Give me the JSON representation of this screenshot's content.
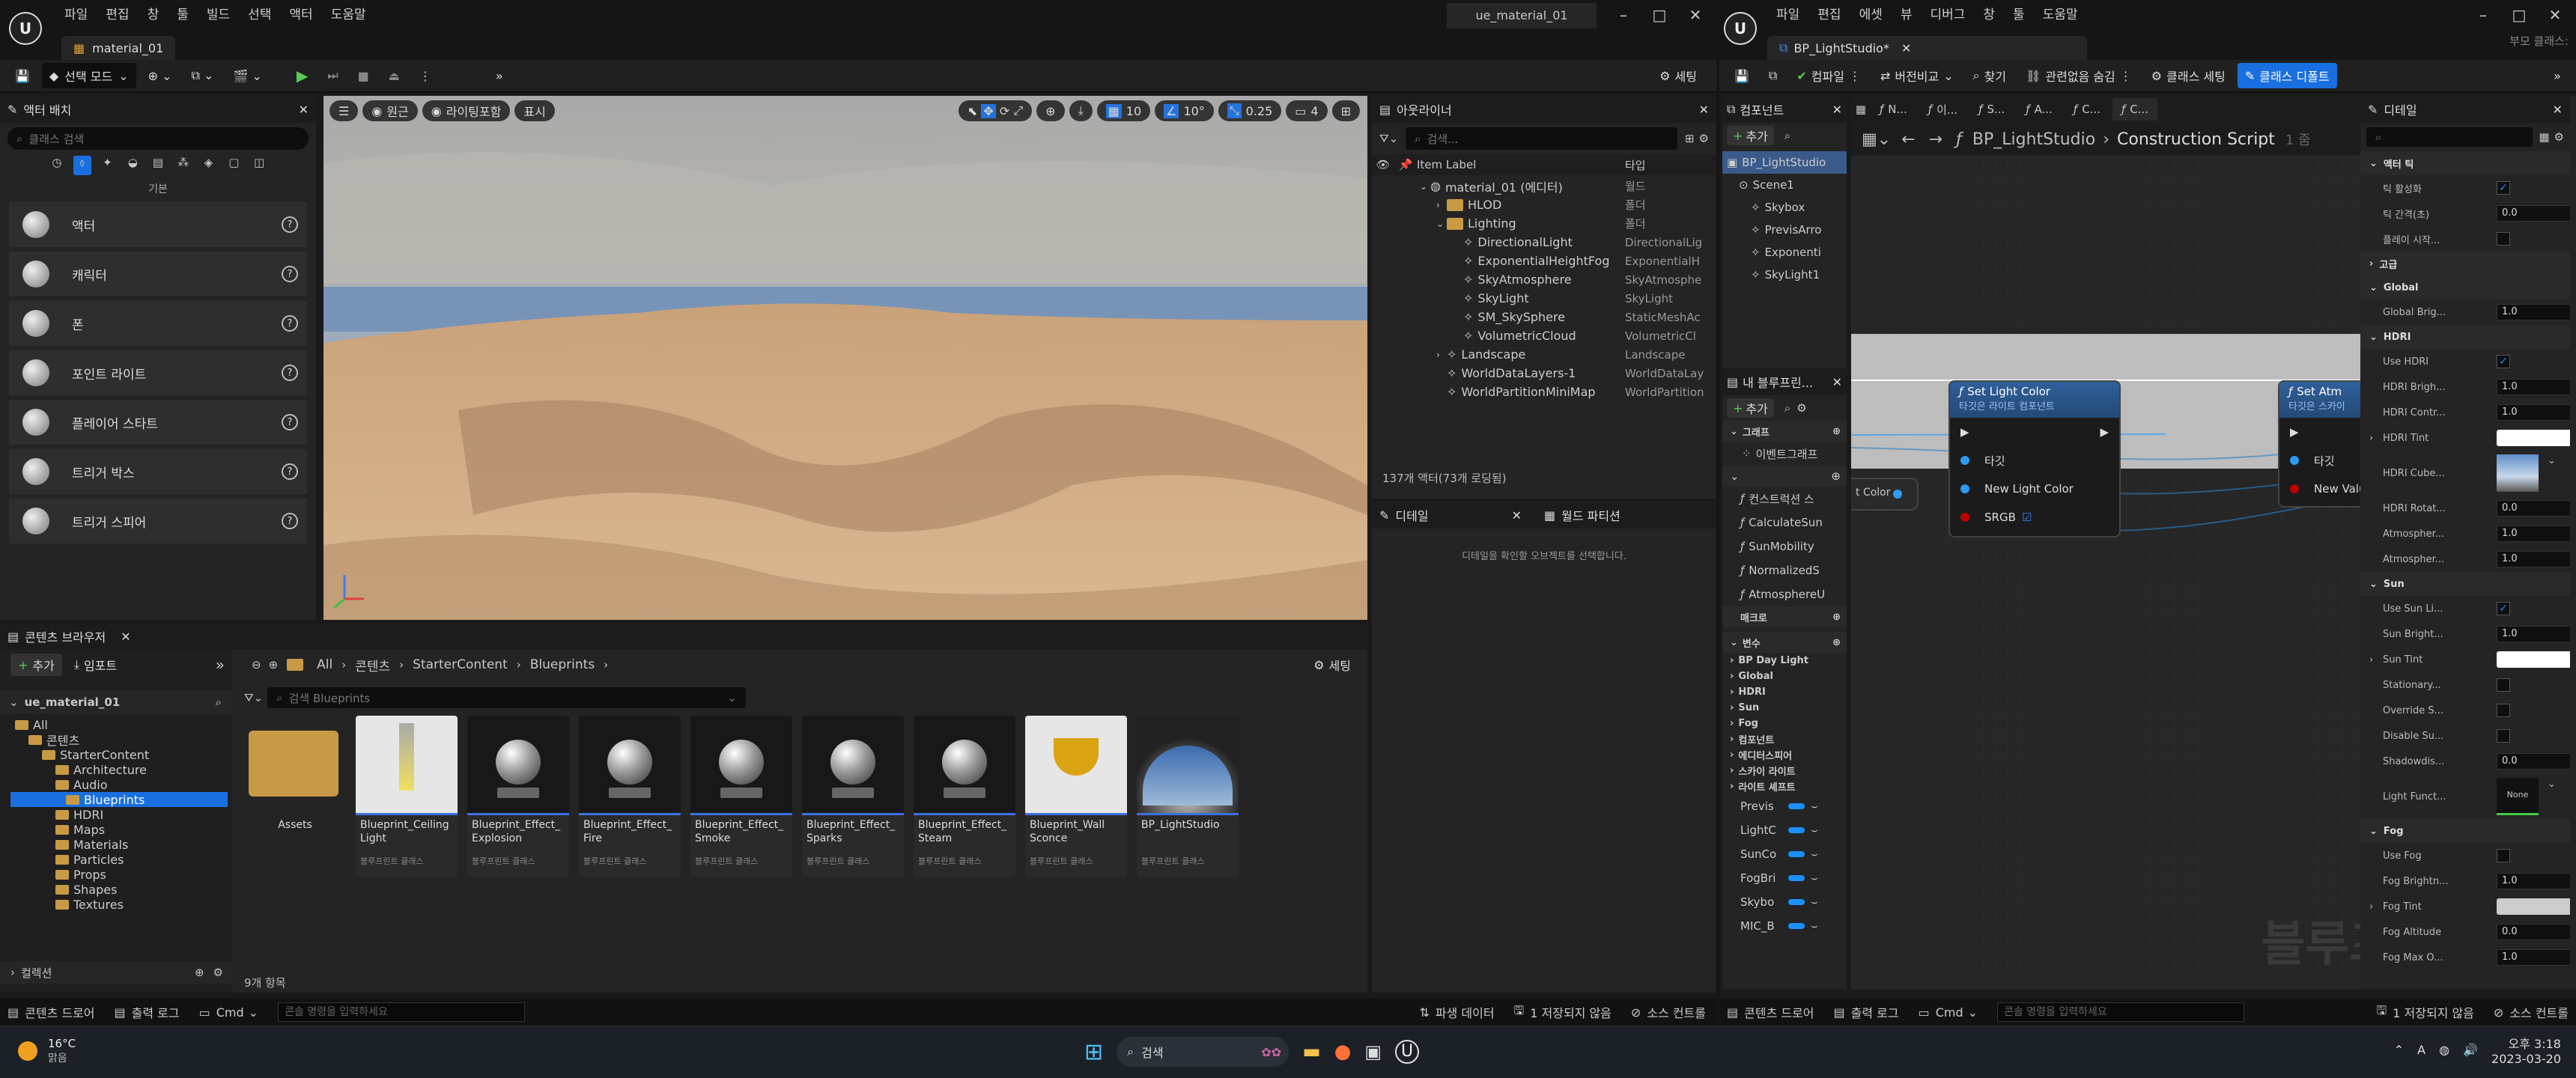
{
  "left_window": {
    "menu": [
      "파일",
      "편집",
      "창",
      "툴",
      "빌드",
      "선택",
      "액터",
      "도움말"
    ],
    "doc_tab": "material_01",
    "level_name": "ue_material_01",
    "toolbar": {
      "select_mode": "선택 모드",
      "settings": "세팅"
    },
    "place_actors": {
      "title": "액터 배치",
      "search_placeholder": "클래스 검색",
      "category": "기본",
      "items": [
        "액터",
        "캐릭터",
        "폰",
        "포인트 라이트",
        "플레이어 스타트",
        "트리거 박스",
        "트리거 스피어"
      ]
    },
    "viewport": {
      "perspective": "원근",
      "lit": "라이팅포함",
      "show": "표시",
      "grid": "10",
      "angle": "10°",
      "scale": "0.25",
      "camera": "4"
    },
    "outliner": {
      "title": "아웃라이너",
      "search_placeholder": "검색...",
      "col_label": "Item Label",
      "col_type": "타입",
      "rows": [
        {
          "label": "material_01 (에디터)",
          "type": "월드",
          "depth": 0,
          "kind": "world"
        },
        {
          "label": "HLOD",
          "type": "폴더",
          "depth": 1,
          "kind": "folder"
        },
        {
          "label": "Lighting",
          "type": "폴더",
          "depth": 1,
          "kind": "folder"
        },
        {
          "label": "DirectionalLight",
          "type": "DirectionalLig",
          "depth": 2,
          "kind": "actor"
        },
        {
          "label": "ExponentialHeightFog",
          "type": "ExponentialH",
          "depth": 2,
          "kind": "actor"
        },
        {
          "label": "SkyAtmosphere",
          "type": "SkyAtmosphe",
          "depth": 2,
          "kind": "actor"
        },
        {
          "label": "SkyLight",
          "type": "SkyLight",
          "depth": 2,
          "kind": "actor"
        },
        {
          "label": "SM_SkySphere",
          "type": "StaticMeshAc",
          "depth": 2,
          "kind": "actor"
        },
        {
          "label": "VolumetricCloud",
          "type": "VolumetricCl",
          "depth": 2,
          "kind": "actor"
        },
        {
          "label": "Landscape",
          "type": "Landscape",
          "depth": 1,
          "kind": "actor"
        },
        {
          "label": "WorldDataLayers-1",
          "type": "WorldDataLay",
          "depth": 1,
          "kind": "actor"
        },
        {
          "label": "WorldPartitionMiniMap",
          "type": "WorldPartition",
          "depth": 1,
          "kind": "actor"
        }
      ],
      "count": "137개 액터(73개 로딩됨)"
    },
    "details": {
      "tab": "디테일",
      "tab2": "월드 파티션",
      "empty": "디테일을 확인할 오브젝트를 선택합니다."
    },
    "content_browser": {
      "title": "콘텐츠 브라우저",
      "add": "추가",
      "import": "임포트",
      "settings": "세팅",
      "path": [
        "All",
        "콘텐츠",
        "StarterContent",
        "Blueprints"
      ],
      "search_placeholder": "검색 Blueprints",
      "root": "ue_material_01",
      "tree": [
        {
          "label": "All",
          "depth": 0
        },
        {
          "label": "콘텐츠",
          "depth": 1
        },
        {
          "label": "StarterContent",
          "depth": 2
        },
        {
          "label": "Architecture",
          "depth": 3
        },
        {
          "label": "Audio",
          "depth": 3
        },
        {
          "label": "Blueprints",
          "depth": 3
        },
        {
          "label": "HDRI",
          "depth": 3
        },
        {
          "label": "Maps",
          "depth": 3
        },
        {
          "label": "Materials",
          "depth": 3
        },
        {
          "label": "Particles",
          "depth": 3
        },
        {
          "label": "Props",
          "depth": 3
        },
        {
          "label": "Shapes",
          "depth": 3
        },
        {
          "label": "Textures",
          "depth": 3
        }
      ],
      "collections": "컬렉션",
      "assets": [
        {
          "name": "Assets",
          "type": ""
        },
        {
          "name": "Blueprint_Ceiling Light",
          "type": "블루프린트 클래스"
        },
        {
          "name": "Blueprint_Effect_ Explosion",
          "type": "블루프린트 클래스"
        },
        {
          "name": "Blueprint_Effect_ Fire",
          "type": "블루프린트 클래스"
        },
        {
          "name": "Blueprint_Effect_ Smoke",
          "type": "블루프린트 클래스"
        },
        {
          "name": "Blueprint_Effect_ Sparks",
          "type": "블루프린트 클래스"
        },
        {
          "name": "Blueprint_Effect_ Steam",
          "type": "블루프린트 클래스"
        },
        {
          "name": "Blueprint_Wall Sconce",
          "type": "블루프린트 클래스"
        },
        {
          "name": "BP_LightStudio",
          "type": "블루프린트 클래스"
        }
      ],
      "item_count": "9개 항목"
    },
    "statusbar": {
      "drawer": "콘텐츠 드로어",
      "log": "출력 로그",
      "cmd": "Cmd",
      "cmd_placeholder": "콘솔 명령을 입력하세요",
      "derived": "파생 데이터",
      "unsaved": "1 저장되지 않음",
      "source": "소스 컨트롤"
    }
  },
  "right_window": {
    "menu": [
      "파일",
      "편집",
      "에셋",
      "뷰",
      "디버그",
      "창",
      "툴",
      "도움말"
    ],
    "doc_tab": "BP_LightStudio*",
    "parent_class": "부모 클래스:",
    "toolbar": {
      "compile": "컴파일",
      "diff": "버전비교",
      "find": "찾기",
      "hide": "관련없음 숨김",
      "class_settings": "클래스 세팅",
      "class_defaults": "클래스 디폴트"
    },
    "components": {
      "title": "컴포넌트",
      "add": "추가",
      "items": [
        "BP_LightStudio",
        "Scene1",
        "Skybox",
        "PrevisArro",
        "Exponenti",
        "SkyLight1"
      ]
    },
    "mybp": {
      "title": "내 블루프린...",
      "add": "추가",
      "graphs": "그래프",
      "event_graph": "이벤트그래프",
      "functions": [
        "컨스트럭션 스",
        "CalculateSun",
        "SunMobility",
        "NormalizedS",
        "AtmosphereU"
      ],
      "macros": "매크로",
      "variables": "변수",
      "var_cats": [
        "BP Day Light",
        "Global",
        "HDRI",
        "Sun",
        "Fog",
        "컴포넌트",
        "에디터스피어",
        "스카이 라이트",
        "라이트 셰프트"
      ],
      "vars": [
        "Previs",
        "LightC",
        "SunCo",
        "FogBri",
        "Skybo",
        "MIC_B"
      ]
    },
    "graph": {
      "tabs": [
        "N...",
        "이...",
        "S...",
        "A...",
        "C...",
        "C..."
      ],
      "breadcrumb_root": "BP_LightStudio",
      "breadcrumb_leaf": "Construction Script",
      "zoom": "1 줌",
      "left_pin": "t Color",
      "node1": {
        "title": "Set Light Color",
        "subtitle": "타깃은 라이트 컴포넌트",
        "pins": [
          "타깃",
          "New Light Color",
          "SRGB"
        ]
      },
      "node2": {
        "title": "Set Atm",
        "subtitle": "타깃은 스카이",
        "pins": [
          "타깃",
          "New Valu"
        ]
      },
      "watermark": "블루프린트"
    },
    "details": {
      "title": "디테일",
      "sections": [
        {
          "name": "액터 틱",
          "rows": [
            {
              "label": "틱 활성화",
              "type": "check",
              "value": "✓"
            },
            {
              "label": "틱 간격(초)",
              "type": "num",
              "value": "0.0"
            },
            {
              "label": "플레이 시작...",
              "type": "check",
              "value": ""
            }
          ]
        },
        {
          "name": "고급",
          "collapsed": true,
          "rows": []
        },
        {
          "name": "Global",
          "rows": [
            {
              "label": "Global Brig...",
              "type": "num",
              "value": "1.0"
            }
          ]
        },
        {
          "name": "HDRI",
          "rows": [
            {
              "label": "Use HDRI",
              "type": "check",
              "value": "✓"
            },
            {
              "label": "HDRI Brigh...",
              "type": "num",
              "value": "1.0"
            },
            {
              "label": "HDRI Contr...",
              "type": "num",
              "value": "1.0"
            },
            {
              "label": "HDRI Tint",
              "type": "swatch",
              "value": "#ffffff"
            },
            {
              "label": "HDRI Cube...",
              "type": "image",
              "value": ""
            },
            {
              "label": "HDRI Rotat...",
              "type": "num",
              "value": "0.0"
            },
            {
              "label": "Atmospher...",
              "type": "num",
              "value": "1.0"
            },
            {
              "label": "Atmospher...",
              "type": "num",
              "value": "1.0"
            }
          ]
        },
        {
          "name": "Sun",
          "rows": [
            {
              "label": "Use Sun Li...",
              "type": "check",
              "value": "✓"
            },
            {
              "label": "Sun Bright...",
              "type": "num",
              "value": "1.0"
            },
            {
              "label": "Sun Tint",
              "type": "swatch",
              "value": "#ffffff"
            },
            {
              "label": "Stationary...",
              "type": "check",
              "value": ""
            },
            {
              "label": "Override S...",
              "type": "check",
              "value": ""
            },
            {
              "label": "Disable Su...",
              "type": "check",
              "value": ""
            },
            {
              "label": "Shadowdis...",
              "type": "num",
              "value": "0.0"
            },
            {
              "label": "Light Funct...",
              "type": "none",
              "value": "None"
            }
          ]
        },
        {
          "name": "Fog",
          "rows": [
            {
              "label": "Use Fog",
              "type": "check",
              "value": ""
            },
            {
              "label": "Fog Brightn...",
              "type": "num",
              "value": "1.0"
            },
            {
              "label": "Fog Tint",
              "type": "swatch",
              "value": "#cccccc"
            },
            {
              "label": "Fog Altitude",
              "type": "num",
              "value": "0.0"
            },
            {
              "label": "Fog Max O...",
              "type": "num",
              "value": "1.0"
            }
          ]
        }
      ]
    },
    "statusbar": {
      "drawer": "콘텐츠 드로어",
      "log": "출력 로그",
      "cmd": "Cmd",
      "cmd_placeholder": "콘솔 명령을 입력하세요",
      "unsaved": "1 저장되지 않음",
      "source": "소스 컨트롤"
    }
  },
  "taskbar": {
    "temp": "16°C",
    "weather": "맑음",
    "search": "검색",
    "ime": "A",
    "time": "오후 3:18",
    "date": "2023-03-20"
  }
}
